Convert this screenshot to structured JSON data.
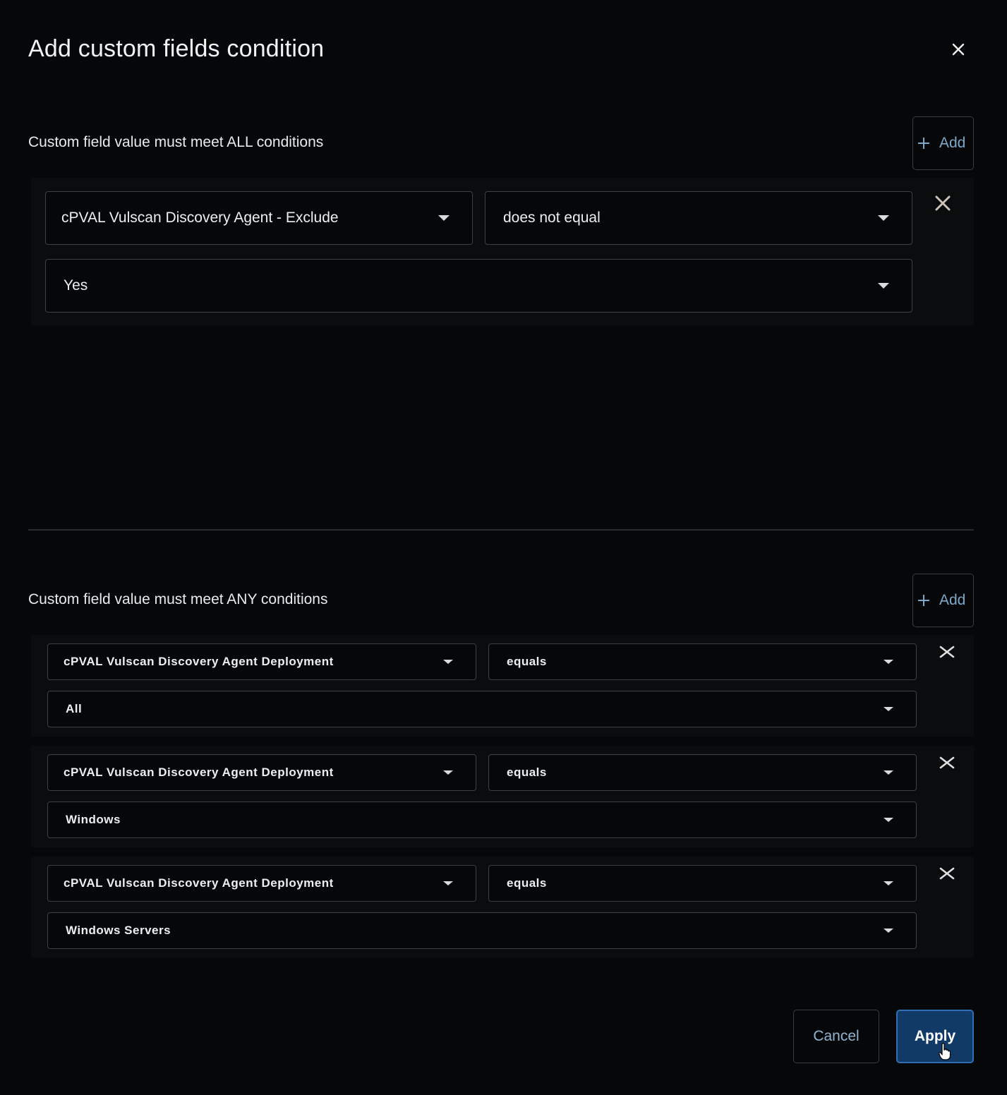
{
  "dialog": {
    "title": "Add custom fields condition"
  },
  "all_section": {
    "label": "Custom field value must meet ALL conditions",
    "add_label": "Add",
    "conditions": [
      {
        "field": "cPVAL Vulscan Discovery Agent - Exclude",
        "operator": "does not equal",
        "value": "Yes"
      }
    ]
  },
  "any_section": {
    "label": "Custom field value must meet ANY conditions",
    "add_label": "Add",
    "conditions": [
      {
        "field": "cPVAL Vulscan Discovery Agent Deployment",
        "operator": "equals",
        "value": "All"
      },
      {
        "field": "cPVAL Vulscan Discovery Agent Deployment",
        "operator": "equals",
        "value": "Windows"
      },
      {
        "field": "cPVAL Vulscan Discovery Agent Deployment",
        "operator": "equals",
        "value": "Windows Servers"
      }
    ]
  },
  "footer": {
    "cancel_label": "Cancel",
    "apply_label": "Apply"
  },
  "colors": {
    "background": "#060708",
    "accent": "#123a66",
    "link": "#7fa7c9"
  }
}
